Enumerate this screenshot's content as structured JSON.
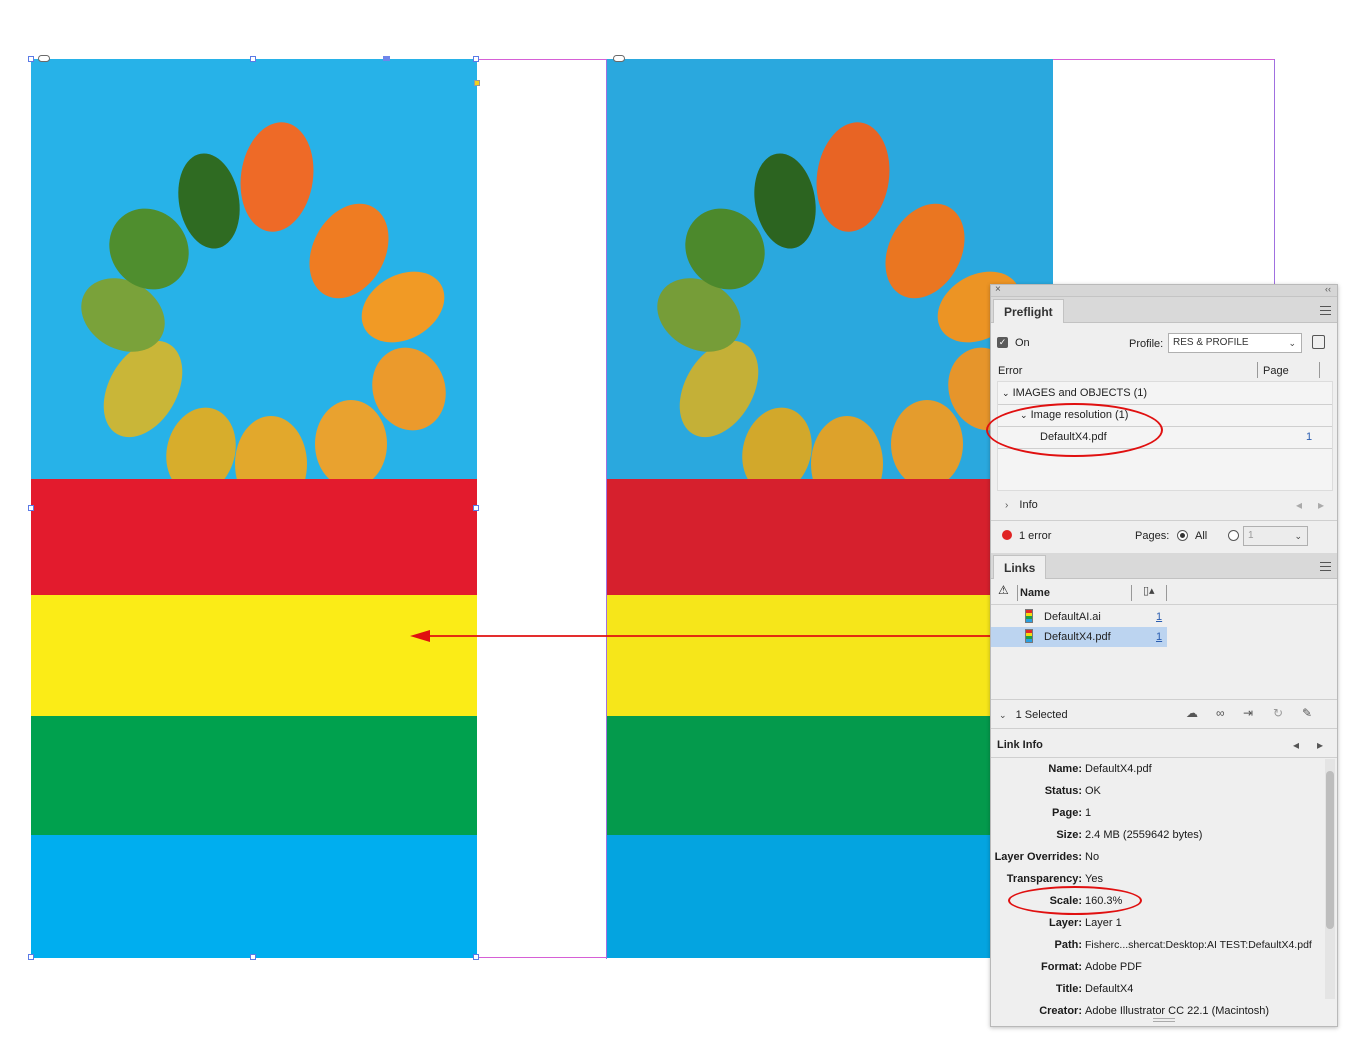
{
  "colors": {
    "sky_blue": "#27b2e8",
    "red": "#e31b2d",
    "yellow": "#fbec17",
    "green": "#00a14e",
    "cyan": "#00aeef",
    "annotation_red": "#e01010"
  },
  "preflight": {
    "tab": "Preflight",
    "on_label": "On",
    "profile_label": "Profile:",
    "profile_value": "RES & PROFILE",
    "col_error": "Error",
    "col_page": "Page",
    "group": "IMAGES and OBJECTS (1)",
    "subgroup": "Image resolution (1)",
    "item_name": "DefaultX4.pdf",
    "item_page": "1",
    "info_label": "Info",
    "error_count": "1 error",
    "pages_label": "Pages:",
    "all_label": "All",
    "page_field": "1"
  },
  "links": {
    "tab": "Links",
    "col_name": "Name",
    "rows": [
      {
        "name": "DefaultAI.ai",
        "page": "1"
      },
      {
        "name": "DefaultX4.pdf",
        "page": "1"
      }
    ],
    "selected_label": "1 Selected"
  },
  "link_info": {
    "title": "Link Info",
    "fields": [
      {
        "key": "Name:",
        "value": "DefaultX4.pdf"
      },
      {
        "key": "Status:",
        "value": "OK"
      },
      {
        "key": "Page:",
        "value": "1"
      },
      {
        "key": "Size:",
        "value": "2.4 MB (2559642 bytes)"
      },
      {
        "key": "Layer Overrides:",
        "value": "No"
      },
      {
        "key": "Transparency:",
        "value": "Yes"
      },
      {
        "key": "Scale:",
        "value": "160.3%"
      },
      {
        "key": "Layer:",
        "value": "Layer 1"
      },
      {
        "key": "Path:",
        "value": "Fisherc...shercat:Desktop:AI TEST:DefaultX4.pdf"
      },
      {
        "key": "Format:",
        "value": "Adobe PDF"
      },
      {
        "key": "Title:",
        "value": "DefaultX4"
      },
      {
        "key": "Creator:",
        "value": "Adobe Illustrator CC 22.1 (Macintosh)"
      }
    ]
  }
}
